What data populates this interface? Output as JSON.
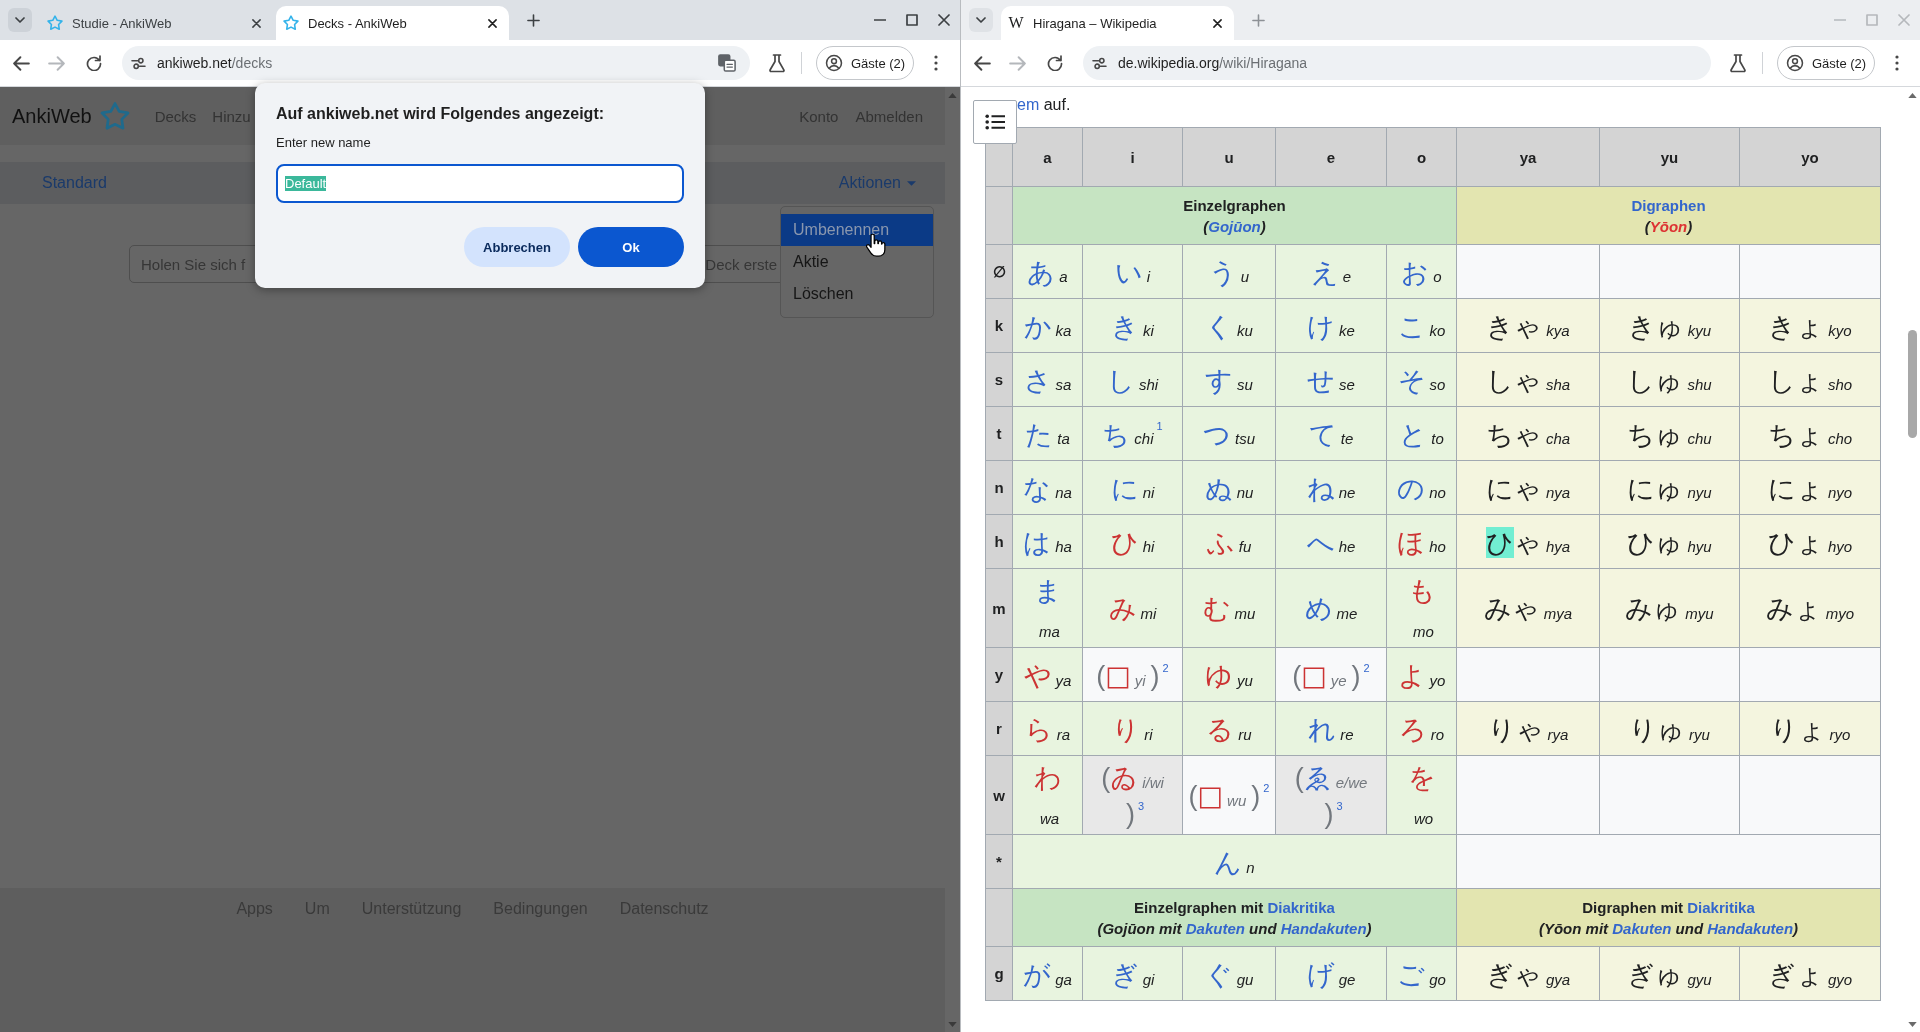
{
  "windows": [
    {
      "focused": true,
      "tabs": [
        {
          "title": "Studie - AnkiWeb",
          "selected": false,
          "kind": "star"
        },
        {
          "title": "Decks - AnkiWeb",
          "selected": true,
          "kind": "star"
        }
      ],
      "address": {
        "host": "ankiweb.net",
        "path": "/decks"
      },
      "translate": true,
      "profile": "Gäste (2)",
      "page": {
        "kind": "ankiweb",
        "brand": "AnkiWeb",
        "nav": [
          "Decks",
          "Hinzu"
        ],
        "account": [
          "Konto",
          "Abmelden"
        ],
        "deck": "Standard",
        "actions": "Aktionen",
        "search": {
          "placeholder": "Holen Sie sich f",
          "placeholder_end": "Deck erste"
        },
        "menu": [
          {
            "label": "Umbenennen",
            "selected": true
          },
          {
            "label": "Aktie",
            "selected": false
          },
          {
            "label": "Löschen",
            "selected": false
          }
        ],
        "footer": [
          "Apps",
          "Um",
          "Unterstützung",
          "Bedingungen",
          "Datenschutz"
        ],
        "dialog": {
          "title": "Auf ankiweb.net wird Folgendes angezeigt:",
          "label": "Enter new name",
          "value": "Default",
          "value_selected": true,
          "buttons": [
            {
              "label": "Abbrechen",
              "kind": "secondary"
            },
            {
              "label": "Ok",
              "kind": "primary"
            }
          ]
        }
      }
    },
    {
      "focused": false,
      "tabs": [
        {
          "title": "Hiragana – Wikipedia",
          "selected": true,
          "kind": "letter",
          "favicon": "W"
        }
      ],
      "address": {
        "host": "de.wikipedia.org",
        "path": "/wiki/Hiragana"
      },
      "translate": false,
      "profile": "Gäste (2)",
      "page": {
        "kind": "wikipedia",
        "intro": [
          {
            "text": "em",
            "kind": "link"
          },
          {
            "text": " auf.",
            "kind": "text"
          }
        ],
        "table": {
          "columns": [
            "a",
            "i",
            "u",
            "e",
            "o",
            "ya",
            "yu",
            "yo"
          ],
          "rows": [
            {
              "cells": [
                {
                  "kind": "group_single",
                  "colspan": 5,
                  "title": [
                    {
                      "text": "Einzelgraphen",
                      "kind": "text"
                    }
                  ],
                  "subtitle": [
                    {
                      "text": "(",
                      "kind": "text"
                    },
                    {
                      "text": "Gojūon",
                      "kind": "link"
                    },
                    {
                      "text": ")",
                      "kind": "text"
                    }
                  ]
                },
                {
                  "kind": "group_digraph",
                  "colspan": 3,
                  "title": [
                    {
                      "text": "Digraphen",
                      "kind": "link"
                    }
                  ],
                  "subtitle": [
                    {
                      "text": "(",
                      "kind": "text"
                    },
                    {
                      "text": "Yōon",
                      "kind": "redlink"
                    },
                    {
                      "text": ")",
                      "kind": "text"
                    }
                  ]
                }
              ]
            },
            {
              "label": "∅",
              "cells": [
                {
                  "kind": "single",
                  "kana": "あ",
                  "romaji": "a",
                  "color": "#3366cc"
                },
                {
                  "kind": "single",
                  "kana": "い",
                  "romaji": "i",
                  "color": "#3366cc"
                },
                {
                  "kind": "single",
                  "kana": "う",
                  "romaji": "u",
                  "color": "#3366cc"
                },
                {
                  "kind": "single",
                  "kana": "え",
                  "romaji": "e",
                  "color": "#3366cc"
                },
                {
                  "kind": "single",
                  "kana": "お",
                  "romaji": "o",
                  "color": "#3366cc"
                },
                {
                  "kind": "empty"
                },
                {
                  "kind": "empty"
                },
                {
                  "kind": "empty"
                }
              ]
            },
            {
              "label": "k",
              "cells": [
                {
                  "kind": "single",
                  "kana": "か",
                  "romaji": "ka",
                  "color": "#3366cc"
                },
                {
                  "kind": "single",
                  "kana": "き",
                  "romaji": "ki",
                  "color": "#3366cc"
                },
                {
                  "kind": "single",
                  "kana": "く",
                  "romaji": "ku",
                  "color": "#3366cc"
                },
                {
                  "kind": "single",
                  "kana": "け",
                  "romaji": "ke",
                  "color": "#3366cc"
                },
                {
                  "kind": "single",
                  "kana": "こ",
                  "romaji": "ko",
                  "color": "#3366cc"
                },
                {
                  "kind": "digraph",
                  "kana": "きゃ",
                  "romaji": "kya",
                  "highlighted": false
                },
                {
                  "kind": "digraph",
                  "kana": "きゅ",
                  "romaji": "kyu",
                  "highlighted": false
                },
                {
                  "kind": "digraph",
                  "kana": "きょ",
                  "romaji": "kyo",
                  "highlighted": false
                }
              ]
            },
            {
              "label": "s",
              "cells": [
                {
                  "kind": "single",
                  "kana": "さ",
                  "romaji": "sa",
                  "color": "#3366cc"
                },
                {
                  "kind": "single",
                  "kana": "し",
                  "romaji": "shi",
                  "color": "#3366cc"
                },
                {
                  "kind": "single",
                  "kana": "す",
                  "romaji": "su",
                  "color": "#3366cc"
                },
                {
                  "kind": "single",
                  "kana": "せ",
                  "romaji": "se",
                  "color": "#3366cc"
                },
                {
                  "kind": "single",
                  "kana": "そ",
                  "romaji": "so",
                  "color": "#3366cc"
                },
                {
                  "kind": "digraph",
                  "kana": "しゃ",
                  "romaji": "sha",
                  "highlighted": false
                },
                {
                  "kind": "digraph",
                  "kana": "しゅ",
                  "romaji": "shu",
                  "highlighted": false
                },
                {
                  "kind": "digraph",
                  "kana": "しょ",
                  "romaji": "sho",
                  "highlighted": false
                }
              ]
            },
            {
              "label": "t",
              "cells": [
                {
                  "kind": "single",
                  "kana": "た",
                  "romaji": "ta",
                  "color": "#3366cc"
                },
                {
                  "kind": "single",
                  "kana": "ち",
                  "romaji": "chi",
                  "color": "#3366cc",
                  "note": "1"
                },
                {
                  "kind": "single",
                  "kana": "つ",
                  "romaji": "tsu",
                  "color": "#3366cc"
                },
                {
                  "kind": "single",
                  "kana": "て",
                  "romaji": "te",
                  "color": "#3366cc"
                },
                {
                  "kind": "single",
                  "kana": "と",
                  "romaji": "to",
                  "color": "#3366cc"
                },
                {
                  "kind": "digraph",
                  "kana": "ちゃ",
                  "romaji": "cha",
                  "highlighted": false
                },
                {
                  "kind": "digraph",
                  "kana": "ちゅ",
                  "romaji": "chu",
                  "highlighted": false
                },
                {
                  "kind": "digraph",
                  "kana": "ちょ",
                  "romaji": "cho",
                  "highlighted": false
                }
              ]
            },
            {
              "label": "n",
              "cells": [
                {
                  "kind": "single",
                  "kana": "な",
                  "romaji": "na",
                  "color": "#3366cc"
                },
                {
                  "kind": "single",
                  "kana": "に",
                  "romaji": "ni",
                  "color": "#3366cc"
                },
                {
                  "kind": "single",
                  "kana": "ぬ",
                  "romaji": "nu",
                  "color": "#3366cc"
                },
                {
                  "kind": "single",
                  "kana": "ね",
                  "romaji": "ne",
                  "color": "#3366cc"
                },
                {
                  "kind": "single",
                  "kana": "の",
                  "romaji": "no",
                  "color": "#3366cc"
                },
                {
                  "kind": "digraph",
                  "kana": "にゃ",
                  "romaji": "nya",
                  "highlighted": false
                },
                {
                  "kind": "digraph",
                  "kana": "にゅ",
                  "romaji": "nyu",
                  "highlighted": false
                },
                {
                  "kind": "digraph",
                  "kana": "にょ",
                  "romaji": "nyo",
                  "highlighted": false
                }
              ]
            },
            {
              "label": "h",
              "cells": [
                {
                  "kind": "single",
                  "kana": "は",
                  "romaji": "ha",
                  "color": "#3366cc"
                },
                {
                  "kind": "single",
                  "kana": "ひ",
                  "romaji": "hi",
                  "color": "#cc3333"
                },
                {
                  "kind": "single",
                  "kana": "ふ",
                  "romaji": "fu",
                  "color": "#cc3333"
                },
                {
                  "kind": "single",
                  "kana": "へ",
                  "romaji": "he",
                  "color": "#3366cc"
                },
                {
                  "kind": "single",
                  "kana": "ほ",
                  "romaji": "ho",
                  "color": "#cc3333"
                },
                {
                  "kind": "digraph",
                  "kana": "ひゃ",
                  "romaji": "hya",
                  "highlighted": true
                },
                {
                  "kind": "digraph",
                  "kana": "ひゅ",
                  "romaji": "hyu",
                  "highlighted": false
                },
                {
                  "kind": "digraph",
                  "kana": "ひょ",
                  "romaji": "hyo",
                  "highlighted": false
                }
              ]
            },
            {
              "label": "m",
              "cells": [
                {
                  "kind": "single",
                  "kana": "ま",
                  "romaji": "ma",
                  "color": "#3366cc"
                },
                {
                  "kind": "single",
                  "kana": "み",
                  "romaji": "mi",
                  "color": "#cc3333"
                },
                {
                  "kind": "single",
                  "kana": "む",
                  "romaji": "mu",
                  "color": "#cc3333"
                },
                {
                  "kind": "single",
                  "kana": "め",
                  "romaji": "me",
                  "color": "#3366cc"
                },
                {
                  "kind": "single",
                  "kana": "も",
                  "romaji": "mo",
                  "color": "#cc3333"
                },
                {
                  "kind": "digraph",
                  "kana": "みゃ",
                  "romaji": "mya",
                  "highlighted": false
                },
                {
                  "kind": "digraph",
                  "kana": "みゅ",
                  "romaji": "myu",
                  "highlighted": false
                },
                {
                  "kind": "digraph",
                  "kana": "みょ",
                  "romaji": "myo",
                  "highlighted": false
                }
              ]
            },
            {
              "label": "y",
              "cells": [
                {
                  "kind": "single",
                  "kana": "や",
                  "romaji": "ya",
                  "color": "#cc3333"
                },
                {
                  "kind": "missing",
                  "open": "(",
                  "kana": "□",
                  "romaji": "yi",
                  "close": ")",
                  "note": "2",
                  "color": "#cc3333"
                },
                {
                  "kind": "single",
                  "kana": "ゆ",
                  "romaji": "yu",
                  "color": "#cc3333"
                },
                {
                  "kind": "missing",
                  "open": "(",
                  "kana": "□",
                  "romaji": "ye",
                  "close": ")",
                  "note": "2",
                  "color": "#cc3333"
                },
                {
                  "kind": "single",
                  "kana": "よ",
                  "romaji": "yo",
                  "color": "#cc3333"
                },
                {
                  "kind": "empty"
                },
                {
                  "kind": "empty"
                },
                {
                  "kind": "empty"
                }
              ]
            },
            {
              "label": "r",
              "cells": [
                {
                  "kind": "single",
                  "kana": "ら",
                  "romaji": "ra",
                  "color": "#cc3333"
                },
                {
                  "kind": "single",
                  "kana": "り",
                  "romaji": "ri",
                  "color": "#cc3333"
                },
                {
                  "kind": "single",
                  "kana": "る",
                  "romaji": "ru",
                  "color": "#cc3333"
                },
                {
                  "kind": "single",
                  "kana": "れ",
                  "romaji": "re",
                  "color": "#3366cc"
                },
                {
                  "kind": "single",
                  "kana": "ろ",
                  "romaji": "ro",
                  "color": "#cc3333"
                },
                {
                  "kind": "digraph",
                  "kana": "りゃ",
                  "romaji": "rya",
                  "highlighted": false
                },
                {
                  "kind": "digraph",
                  "kana": "りゅ",
                  "romaji": "ryu",
                  "highlighted": false
                },
                {
                  "kind": "digraph",
                  "kana": "りょ",
                  "romaji": "ryo",
                  "highlighted": false
                }
              ]
            },
            {
              "label": "w",
              "cells": [
                {
                  "kind": "single",
                  "kana": "わ",
                  "romaji": "wa",
                  "color": "#cc3333"
                },
                {
                  "kind": "historic",
                  "open": "(",
                  "kana": "ゐ",
                  "romaji": "i/wi",
                  "close": ")",
                  "note": "3",
                  "color": "#cc3333"
                },
                {
                  "kind": "missing",
                  "open": "(",
                  "kana": "□",
                  "romaji": "wu",
                  "close": ")",
                  "note": "2",
                  "color": "#cc3333"
                },
                {
                  "kind": "historic",
                  "open": "(",
                  "kana": "ゑ",
                  "romaji": "e/we",
                  "close": ")",
                  "note": "3",
                  "color": "#3366cc"
                },
                {
                  "kind": "single",
                  "kana": "を",
                  "romaji": "wo",
                  "color": "#cc3333"
                },
                {
                  "kind": "empty"
                },
                {
                  "kind": "empty"
                },
                {
                  "kind": "empty"
                }
              ]
            },
            {
              "label": "*",
              "cells": [
                {
                  "kind": "single",
                  "colspan": 5,
                  "kana": "ん",
                  "romaji": "n",
                  "color": "#3366cc"
                },
                {
                  "kind": "empty",
                  "colspan": 3
                }
              ]
            },
            {
              "cells": [
                {
                  "kind": "group_single",
                  "colspan": 5,
                  "title": [
                    {
                      "text": "Einzelgraphen mit ",
                      "kind": "text"
                    },
                    {
                      "text": "Diakritika",
                      "kind": "link"
                    }
                  ],
                  "subtitle": [
                    {
                      "text": "(Gojūon mit ",
                      "kind": "text"
                    },
                    {
                      "text": "Dakuten",
                      "kind": "link"
                    },
                    {
                      "text": " und ",
                      "kind": "text"
                    },
                    {
                      "text": "Handakuten",
                      "kind": "link"
                    },
                    {
                      "text": ")",
                      "kind": "text"
                    }
                  ]
                },
                {
                  "kind": "group_digraph",
                  "colspan": 3,
                  "title": [
                    {
                      "text": "Digraphen mit ",
                      "kind": "text"
                    },
                    {
                      "text": "Diakritika",
                      "kind": "link"
                    }
                  ],
                  "subtitle": [
                    {
                      "text": "(Yōon mit ",
                      "kind": "text"
                    },
                    {
                      "text": "Dakuten",
                      "kind": "link"
                    },
                    {
                      "text": " und ",
                      "kind": "text"
                    },
                    {
                      "text": "Handakuten",
                      "kind": "link"
                    },
                    {
                      "text": ")",
                      "kind": "text"
                    }
                  ]
                }
              ]
            },
            {
              "label": "g",
              "cells": [
                {
                  "kind": "single",
                  "kana": "が",
                  "romaji": "ga",
                  "color": "#3366cc"
                },
                {
                  "kind": "single",
                  "kana": "ぎ",
                  "romaji": "gi",
                  "color": "#3366cc"
                },
                {
                  "kind": "single",
                  "kana": "ぐ",
                  "romaji": "gu",
                  "color": "#3366cc"
                },
                {
                  "kind": "single",
                  "kana": "げ",
                  "romaji": "ge",
                  "color": "#3366cc"
                },
                {
                  "kind": "single",
                  "kana": "ご",
                  "romaji": "go",
                  "color": "#3366cc"
                },
                {
                  "kind": "digraph",
                  "kana": "ぎゃ",
                  "romaji": "gya",
                  "highlighted": false
                },
                {
                  "kind": "digraph",
                  "kana": "ぎゅ",
                  "romaji": "gyu",
                  "highlighted": false
                },
                {
                  "kind": "digraph",
                  "kana": "ぎょ",
                  "romaji": "gyo",
                  "highlighted": false
                }
              ]
            }
          ]
        }
      }
    }
  ]
}
